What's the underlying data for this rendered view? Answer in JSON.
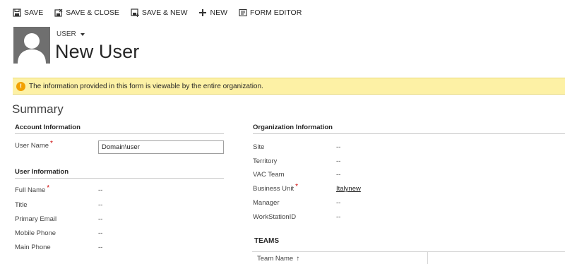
{
  "toolbar": {
    "save": "SAVE",
    "save_close": "SAVE & CLOSE",
    "save_new": "SAVE & NEW",
    "new": "NEW",
    "form_editor": "FORM EDITOR"
  },
  "header": {
    "entity_type": "USER",
    "record_title": "New User"
  },
  "notification": {
    "text": "The information provided in this form is viewable by the entire organization."
  },
  "summary": {
    "title": "Summary"
  },
  "account_information": {
    "heading": "Account Information",
    "user_name_label": "User Name",
    "user_name_value": "Domain\\user"
  },
  "user_information": {
    "heading": "User Information",
    "fields": [
      {
        "label": "Full Name",
        "value": "--"
      },
      {
        "label": "Title",
        "value": "--"
      },
      {
        "label": "Primary Email",
        "value": "--"
      },
      {
        "label": "Mobile Phone",
        "value": "--"
      },
      {
        "label": "Main Phone",
        "value": "--"
      }
    ]
  },
  "organization_information": {
    "heading": "Organization Information",
    "fields": [
      {
        "label": "Site",
        "value": "--"
      },
      {
        "label": "Territory",
        "value": "--"
      },
      {
        "label": "VAC Team",
        "value": "--"
      },
      {
        "label": "Business Unit",
        "value": "Italynew"
      },
      {
        "label": "Manager",
        "value": "--"
      },
      {
        "label": "WorkStationID",
        "value": "--"
      }
    ]
  },
  "teams": {
    "title": "TEAMS",
    "column": "Team Name"
  },
  "colors": {
    "notice_bg": "#fdf1a5",
    "warning": "#f2a100",
    "required": "#cc0000",
    "avatar": "#6f6f6f"
  }
}
